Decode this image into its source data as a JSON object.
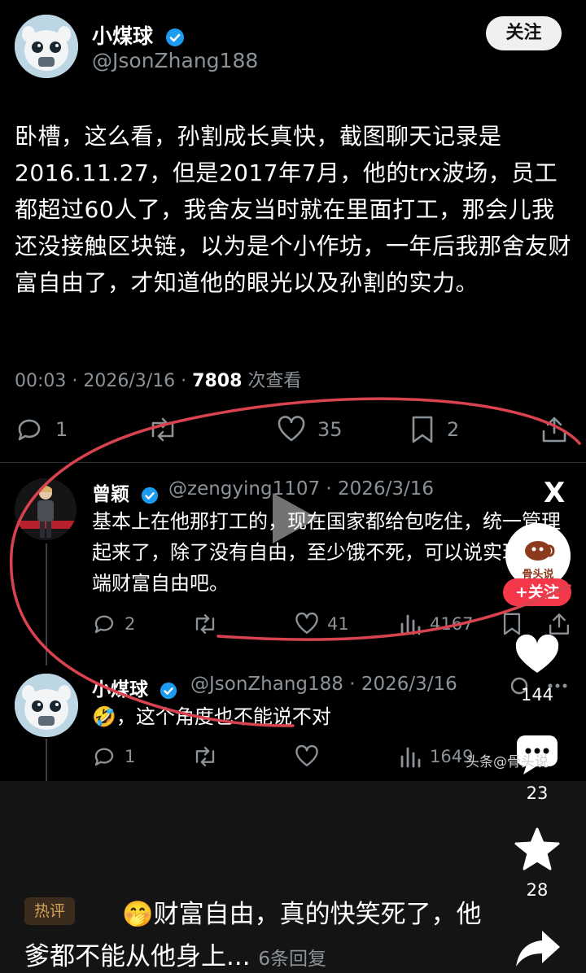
{
  "post": {
    "author_name": "小煤球",
    "handle": "@JsonZhang188",
    "follow_label": "关注",
    "body": "卧槽，这么看，孙割成长真快，截图聊天记录是2016.11.27，但是2017年7月，他的trx波场，员工都超过60人了，我舍友当时就在里面打工，那会儿我还没接触区块链，以为是个小作坊，一年后我那舍友财富自由了，才知道他的眼光以及孙割的实力。",
    "meta_prefix": "00:03 · 2026/3/16 · ",
    "views": "7808",
    "views_suffix": " 次查看",
    "reply_count": "1",
    "like_count": "35",
    "bookmark_count": "2"
  },
  "reply1": {
    "name": "曾颖",
    "handle_time": "@zengying1107 · 2026/3/16",
    "text": "基本上在他那打工的，现在国家都给包吃住，统一管理起来了，除了没有自由，至少饿不死，可以说实现了低端财富自由吧。",
    "reply_count": "2",
    "like_count": "41",
    "view_count": "4167"
  },
  "reply2": {
    "name": "小煤球",
    "handle_time": "@JsonZhang188 · 2026/3/16",
    "text": "🤣，这个角度也不能说不对",
    "reply_count": "1",
    "view_count": "1649"
  },
  "overlay": {
    "brand_label": "骨头说",
    "follow_chip": "+关注",
    "like_count": "144",
    "comment_count": "23",
    "star_count": "28",
    "watermark": "头条@骨头说",
    "x_logo": "X"
  },
  "hot_comment": {
    "tag": "热评",
    "emoji": "🤭",
    "text": "财富自由，真的快笑死了，他爹都不能从他身上...",
    "replies": "6条回复"
  },
  "colors": {
    "background": "#000000",
    "muted": "#8b9298",
    "verified": "#1d9bf0",
    "annotation": "#d8434f",
    "follow_red": "#f5374a"
  }
}
